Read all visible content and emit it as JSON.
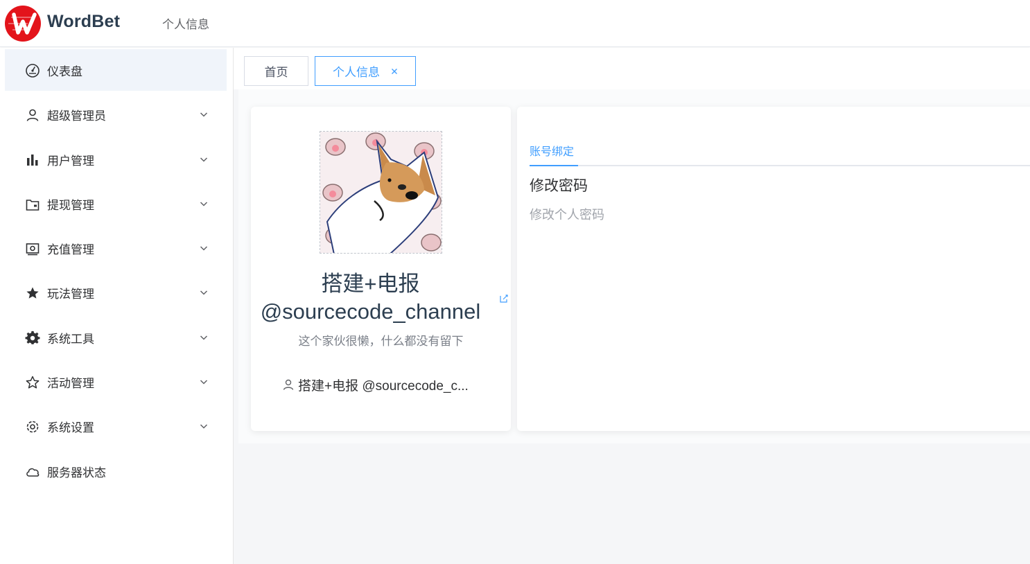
{
  "header": {
    "brand": "WordBet",
    "breadcrumb": "个人信息"
  },
  "sidebar": {
    "items": [
      {
        "label": "仪表盘",
        "icon": "dashboard-icon",
        "active": true,
        "has_arrow": false
      },
      {
        "label": "超级管理员",
        "icon": "user-icon",
        "has_arrow": true
      },
      {
        "label": "用户管理",
        "icon": "bar-chart-icon",
        "has_arrow": true
      },
      {
        "label": "提现管理",
        "icon": "wallet-icon",
        "has_arrow": true
      },
      {
        "label": "充值管理",
        "icon": "money-icon",
        "has_arrow": true
      },
      {
        "label": "玩法管理",
        "icon": "star-filled-icon",
        "has_arrow": true
      },
      {
        "label": "系统工具",
        "icon": "gear-filled-icon",
        "has_arrow": true
      },
      {
        "label": "活动管理",
        "icon": "star-outline-icon",
        "has_arrow": true
      },
      {
        "label": "系统设置",
        "icon": "settings-icon",
        "has_arrow": true
      },
      {
        "label": "服务器状态",
        "icon": "cloud-icon",
        "has_arrow": false
      }
    ]
  },
  "tabs": [
    {
      "label": "首页"
    },
    {
      "label": "个人信息",
      "active": true
    }
  ],
  "profile": {
    "nickname": "搭建+电报 @sourcecode_channel",
    "signature": "这个家伙很懒，什么都没有留下",
    "username": "搭建+电报 @sourcecode_c..."
  },
  "account": {
    "tab": "账号绑定",
    "title": "修改密码",
    "desc": "修改个人密码"
  },
  "colors": {
    "accent": "#409eff",
    "logo_red": "#e3141b"
  }
}
